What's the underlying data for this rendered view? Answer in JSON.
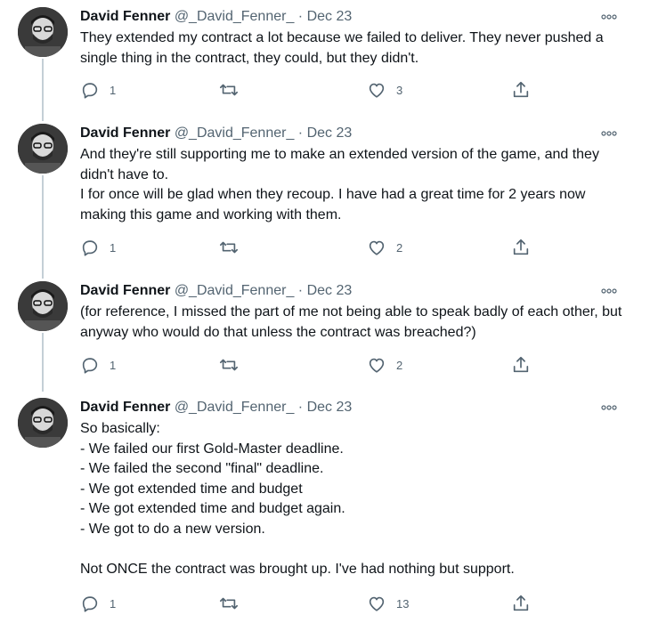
{
  "tweets": [
    {
      "name": "David Fenner",
      "handle": "@_David_Fenner_",
      "sep": " · ",
      "date": "Dec 23",
      "text": "They extended my contract a lot because we failed to deliver. They never pushed a single thing in the contract, they could, but they didn't.",
      "replies": "1",
      "retweets": "",
      "likes": "3"
    },
    {
      "name": "David Fenner",
      "handle": "@_David_Fenner_",
      "sep": " · ",
      "date": "Dec 23",
      "text": "And they're still supporting me to make an extended version of the game, and they didn't have to.\nI for once will be glad when they recoup. I have had a great time for 2 years now making this game and working with them.",
      "replies": "1",
      "retweets": "",
      "likes": "2"
    },
    {
      "name": "David Fenner",
      "handle": "@_David_Fenner_",
      "sep": " · ",
      "date": "Dec 23",
      "text": "(for reference, I missed the part of me not being able to speak badly of each other, but anyway who would do that unless the contract was breached?)",
      "replies": "1",
      "retweets": "",
      "likes": "2"
    },
    {
      "name": "David Fenner",
      "handle": "@_David_Fenner_",
      "sep": " · ",
      "date": "Dec 23",
      "text": "So basically:\n- We failed our first Gold-Master deadline.\n- We failed the second \"final\" deadline.\n- We got extended time and budget\n- We got extended time and budget again.\n- We got to do a new version.\n\nNot ONCE the contract was brought up. I've had nothing but support.",
      "replies": "1",
      "retweets": "",
      "likes": "13"
    }
  ],
  "icons": {
    "more": "more-horizontal-icon",
    "reply": "reply-bubble-icon",
    "retweet": "retweet-arrows-icon",
    "like": "heart-outline-icon",
    "share": "share-upload-icon"
  },
  "colors": {
    "text": "#0f1419",
    "secondary": "#536471",
    "thread_line": "#c4cfd6"
  }
}
